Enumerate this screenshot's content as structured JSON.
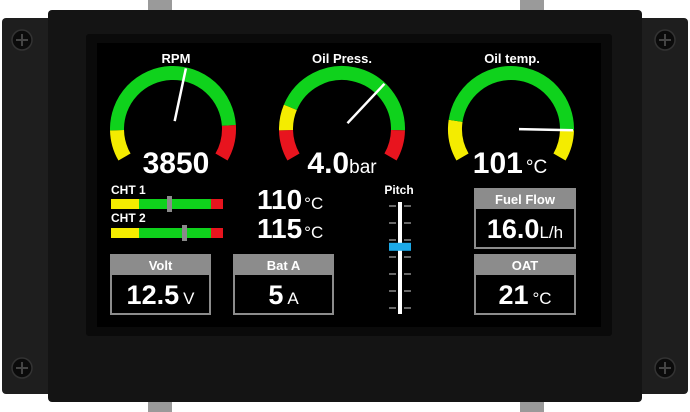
{
  "gauges": [
    {
      "label": "RPM",
      "value": "3850",
      "unit": "",
      "needle": 0.55
    },
    {
      "label": "Oil Press.",
      "value": "4.0",
      "unit": "bar",
      "needle": 0.68
    },
    {
      "label": "Oil temp.",
      "value": "101",
      "unit": "°C",
      "needle": 0.88
    }
  ],
  "cht": [
    {
      "label": "CHT 1",
      "value": "110",
      "unit": "°C",
      "level": 0.52
    },
    {
      "label": "CHT 2",
      "value": "115",
      "unit": "°C",
      "level": 0.66
    }
  ],
  "pitch": {
    "label": "Pitch",
    "level": 0.4
  },
  "boxes": {
    "volt": {
      "label": "Volt",
      "value": "12.5",
      "unit": "V"
    },
    "bat": {
      "label": "Bat A",
      "value": "5",
      "unit": "A"
    },
    "fuel": {
      "label": "Fuel Flow",
      "value": "16.0",
      "unit": "L/h"
    },
    "oat": {
      "label": "OAT",
      "value": "21",
      "unit": "°C"
    }
  },
  "colors": {
    "green": "#0fd21c",
    "yellow": "#f4ec00",
    "red": "#e8141e",
    "grey": "#8c8c8c",
    "marker": "#1ca9e8"
  }
}
